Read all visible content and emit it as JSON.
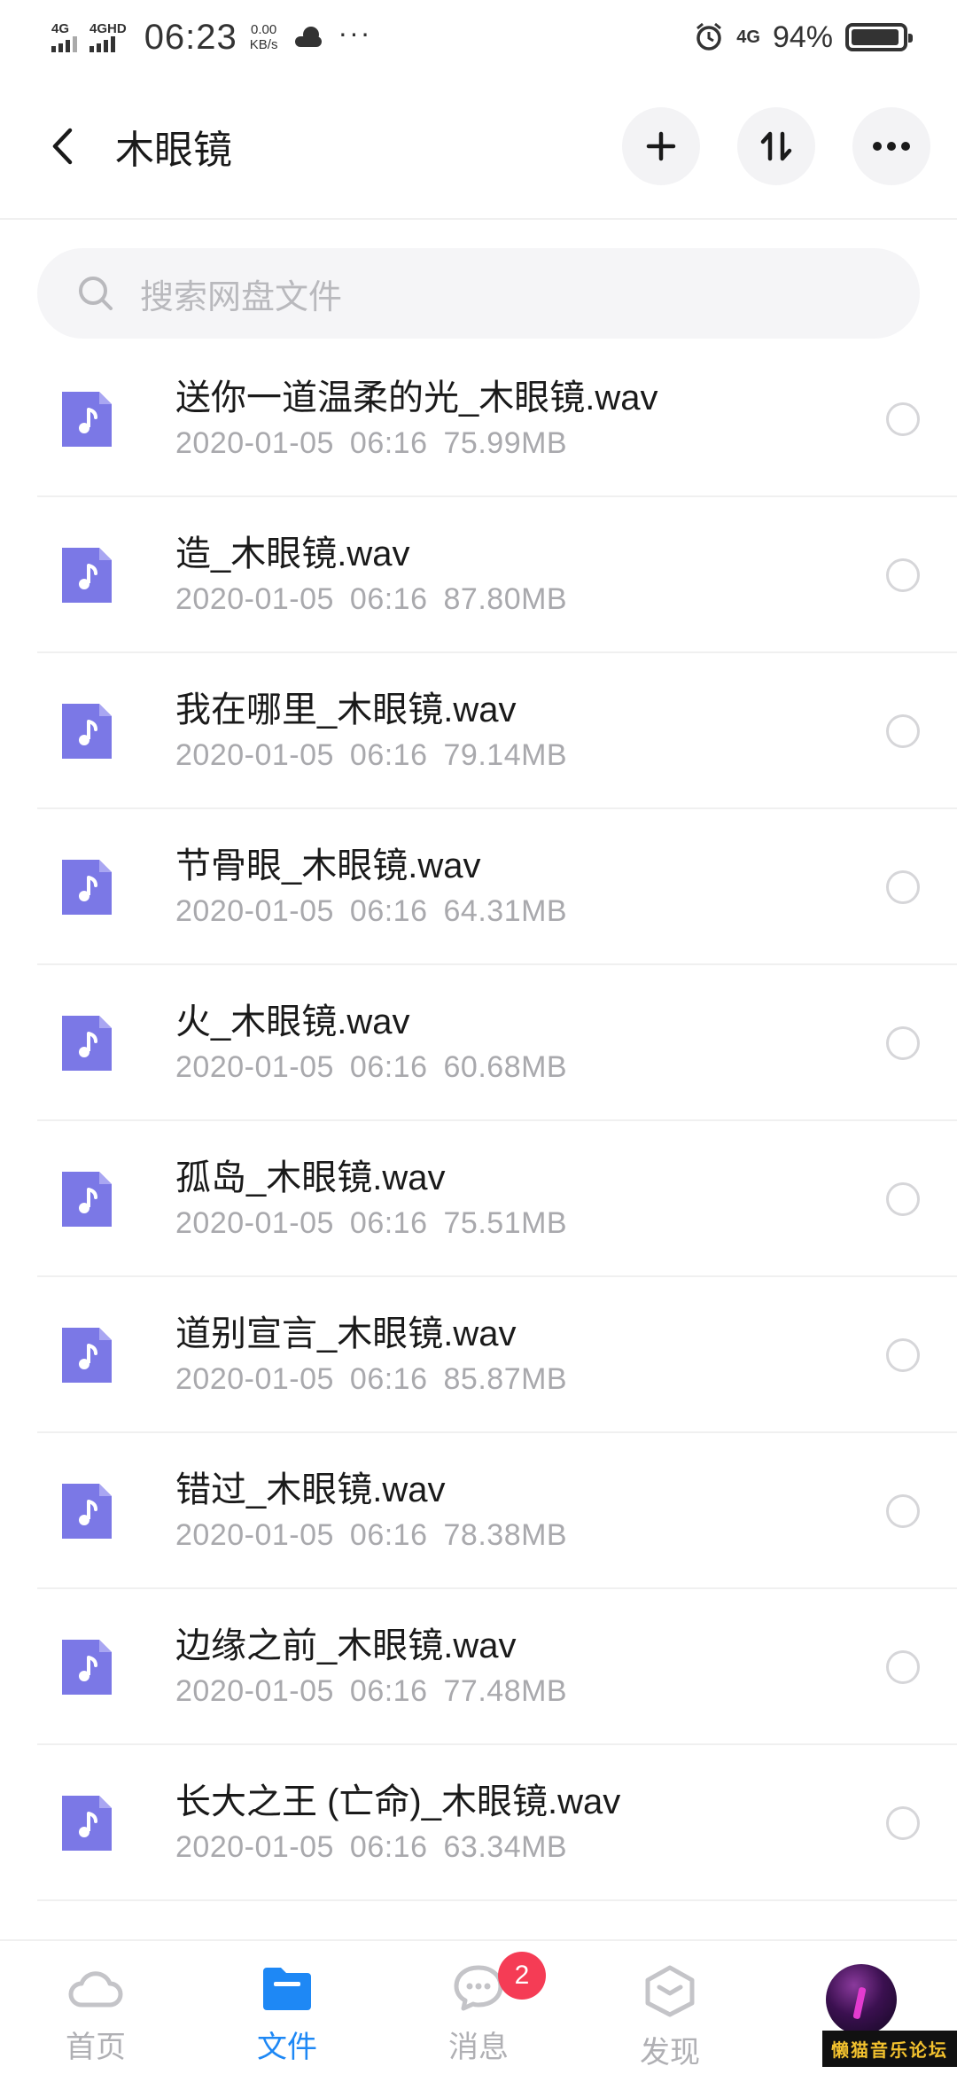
{
  "status_bar": {
    "signal1_label": "4G",
    "signal2_label": "4GHD",
    "time": "06:23",
    "speed_value": "0.00",
    "speed_unit": "KB/s",
    "more": "···",
    "network_right": "4G",
    "battery": "94%",
    "battery_level": 0.94
  },
  "header": {
    "title": "木眼镜",
    "back_icon": "chevron-left-icon",
    "actions": [
      "plus-icon",
      "sort-icon",
      "more-icon"
    ]
  },
  "search": {
    "placeholder": "搜索网盘文件"
  },
  "files": [
    {
      "name": "送你一道温柔的光_木眼镜.wav",
      "date": "2020-01-05",
      "time": "06:16",
      "size": "75.99MB"
    },
    {
      "name": "造_木眼镜.wav",
      "date": "2020-01-05",
      "time": "06:16",
      "size": "87.80MB"
    },
    {
      "name": "我在哪里_木眼镜.wav",
      "date": "2020-01-05",
      "time": "06:16",
      "size": "79.14MB"
    },
    {
      "name": "节骨眼_木眼镜.wav",
      "date": "2020-01-05",
      "time": "06:16",
      "size": "64.31MB"
    },
    {
      "name": "火_木眼镜.wav",
      "date": "2020-01-05",
      "time": "06:16",
      "size": "60.68MB"
    },
    {
      "name": "孤岛_木眼镜.wav",
      "date": "2020-01-05",
      "time": "06:16",
      "size": "75.51MB"
    },
    {
      "name": "道别宣言_木眼镜.wav",
      "date": "2020-01-05",
      "time": "06:16",
      "size": "85.87MB"
    },
    {
      "name": "错过_木眼镜.wav",
      "date": "2020-01-05",
      "time": "06:16",
      "size": "78.38MB"
    },
    {
      "name": "边缘之前_木眼镜.wav",
      "date": "2020-01-05",
      "time": "06:16",
      "size": "77.48MB"
    },
    {
      "name": "长大之王 (亡命)_木眼镜.wav",
      "date": "2020-01-05",
      "time": "06:16",
      "size": "63.34MB"
    }
  ],
  "bottom_nav": {
    "items": [
      {
        "label": "首页",
        "icon": "cloud-icon"
      },
      {
        "label": "文件",
        "icon": "folder-icon"
      },
      {
        "label": "消息",
        "icon": "chat-icon"
      },
      {
        "label": "发现",
        "icon": "cube-icon"
      },
      {
        "label": "",
        "icon": "avatar"
      }
    ],
    "message_badge": "2",
    "watermark": "懒猫音乐论坛"
  },
  "colors": {
    "accent": "#1e88f5",
    "file_icon": "#7b78e6",
    "badge": "#f53c55"
  }
}
